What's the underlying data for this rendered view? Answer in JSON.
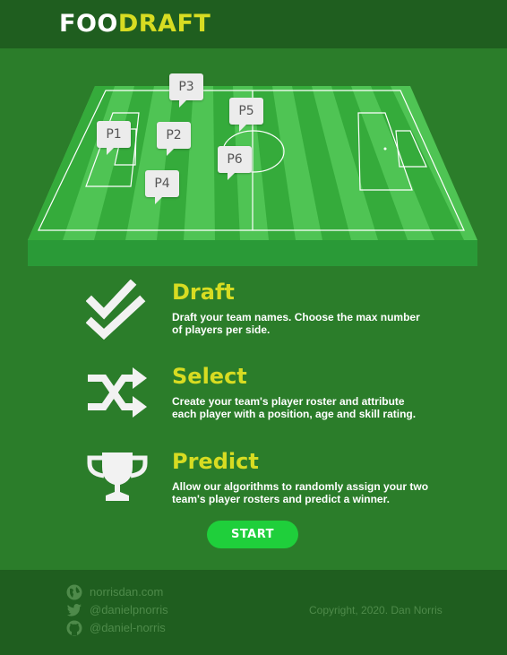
{
  "header": {
    "logo_part1": "FOO",
    "logo_part2": "DRAFT"
  },
  "pitch": {
    "players": [
      "P1",
      "P2",
      "P3",
      "P4",
      "P5",
      "P6"
    ]
  },
  "features": [
    {
      "icon": "double-check-icon",
      "title": "Draft",
      "description": "Draft your team names. Choose the max number of players per side."
    },
    {
      "icon": "shuffle-icon",
      "title": "Select",
      "description": "Create your team's player roster and attribute each player with a position, age and skill rating."
    },
    {
      "icon": "trophy-icon",
      "title": "Predict",
      "description": "Allow our algorithms to randomly assign your two team's player rosters and predict a winner."
    }
  ],
  "start_button": "START",
  "footer": {
    "website": "norrisdan.com",
    "twitter": "@danielpnorris",
    "github": "@daniel-norris",
    "copyright": "Copyright, 2020. Dan Norris"
  },
  "colors": {
    "background": "#2b7d2a",
    "header": "#1f5e1f",
    "accent": "#d7dc22",
    "button": "#1fcf3b"
  }
}
